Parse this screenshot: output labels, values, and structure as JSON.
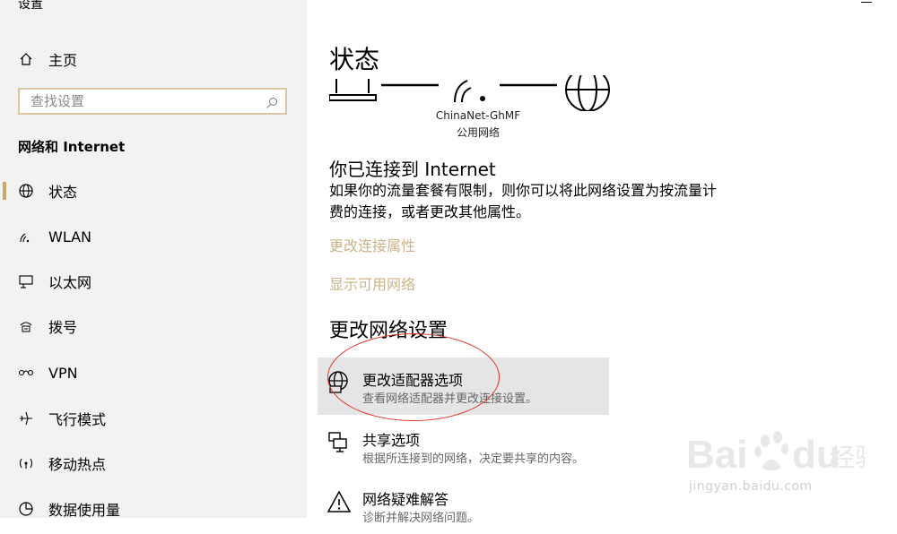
{
  "app": {
    "title": "设置"
  },
  "sidebar": {
    "home_label": "主页",
    "search_placeholder": "查找设置",
    "section_title": "网络和 Internet",
    "items": [
      {
        "label": "状态",
        "icon": "globe-icon",
        "active": true
      },
      {
        "label": "WLAN",
        "icon": "wifi-icon"
      },
      {
        "label": "以太网",
        "icon": "ethernet-icon"
      },
      {
        "label": "拨号",
        "icon": "dialup-icon"
      },
      {
        "label": "VPN",
        "icon": "vpn-icon"
      },
      {
        "label": "飞行模式",
        "icon": "airplane-icon"
      },
      {
        "label": "移动热点",
        "icon": "hotspot-icon"
      },
      {
        "label": "数据使用量",
        "icon": "data-usage-icon"
      }
    ]
  },
  "main": {
    "title": "状态",
    "network_name": "ChinaNet-GhMF",
    "network_type": "公用网络",
    "connected_title": "你已连接到 Internet",
    "connected_desc": "如果你的流量套餐有限制，则你可以将此网络设置为按流量计费的连接，或者更改其他属性。",
    "link_change_props": "更改连接属性",
    "link_show_networks": "显示可用网络",
    "change_section_title": "更改网络设置",
    "options": [
      {
        "title": "更改适配器选项",
        "desc": "查看网络适配器并更改连接设置。",
        "icon": "adapter-icon"
      },
      {
        "title": "共享选项",
        "desc": "根据所连接到的网络，决定要共享的内容。",
        "icon": "sharing-icon"
      },
      {
        "title": "网络疑难解答",
        "desc": "诊断并解决网络问题。",
        "icon": "warning-icon"
      }
    ]
  },
  "watermark": {
    "brand": "Baidu经验",
    "url": "jingyan.baidu.com"
  },
  "colors": {
    "accent": "#c9a86a",
    "link": "#c9b48a",
    "annotation": "#e0332d"
  }
}
